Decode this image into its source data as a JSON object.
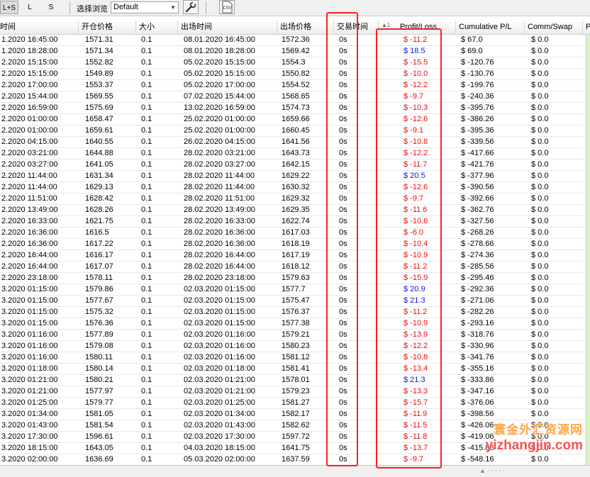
{
  "toolbar": {
    "btn_ls": "L+S",
    "btn_l": "L",
    "btn_s": "S",
    "browse_label": "选择浏览",
    "browse_value": "Default",
    "csv_label": "CSV"
  },
  "columns": [
    {
      "key": "entry_time",
      "label": "时间"
    },
    {
      "key": "entry_price",
      "label": "开仓价格"
    },
    {
      "key": "size",
      "label": "大小"
    },
    {
      "key": "exit_time",
      "label": "出场时间"
    },
    {
      "key": "exit_price",
      "label": "出场价格"
    },
    {
      "key": "duration",
      "label": "交易时间"
    },
    {
      "key": "pl",
      "label": "Profit/Loss"
    },
    {
      "key": "cum_pl",
      "label": "Cumulative P/L"
    },
    {
      "key": "comm",
      "label": "Comm/Swap"
    },
    {
      "key": "p",
      "label": "P"
    }
  ],
  "sort_indicator": "▲1",
  "rows": [
    [
      "1.2020 16:45:00",
      "1571.31",
      "0.1",
      "08.01.2020 16:45:00",
      "1572.36",
      "0s",
      "$ -11.2",
      "$ 67.0",
      "$ 0.0"
    ],
    [
      "1.2020 18:28:00",
      "1571.34",
      "0.1",
      "08.01.2020 18:28:00",
      "1569.42",
      "0s",
      "$ 18.5",
      "$ 69.0",
      "$ 0.0"
    ],
    [
      "2.2020 15:15:00",
      "1552.82",
      "0.1",
      "05.02.2020 15:15:00",
      "1554.3",
      "0s",
      "$ -15.5",
      "$ -120.76",
      "$ 0.0"
    ],
    [
      "2.2020 15:15:00",
      "1549.89",
      "0.1",
      "05.02.2020 15:15:00",
      "1550.82",
      "0s",
      "$ -10.0",
      "$ -130.76",
      "$ 0.0"
    ],
    [
      "2.2020 17:00:00",
      "1553.37",
      "0.1",
      "05.02.2020 17:00:00",
      "1554.52",
      "0s",
      "$ -12.2",
      "$ -199.76",
      "$ 0.0"
    ],
    [
      "2.2020 15:44:00",
      "1569.55",
      "0.1",
      "07.02.2020 15:44:00",
      "1568.65",
      "0s",
      "$ -9.7",
      "$ -240.36",
      "$ 0.0"
    ],
    [
      "2.2020 16:59:00",
      "1575.69",
      "0.1",
      "13.02.2020 16:59:00",
      "1574.73",
      "0s",
      "$ -10.3",
      "$ -395.76",
      "$ 0.0"
    ],
    [
      "2.2020 01:00:00",
      "1658.47",
      "0.1",
      "25.02.2020 01:00:00",
      "1659.66",
      "0s",
      "$ -12.6",
      "$ -386.26",
      "$ 0.0"
    ],
    [
      "2.2020 01:00:00",
      "1659.61",
      "0.1",
      "25.02.2020 01:00:00",
      "1660.45",
      "0s",
      "$ -9.1",
      "$ -395.36",
      "$ 0.0"
    ],
    [
      "2.2020 04:15:00",
      "1640.55",
      "0.1",
      "26.02.2020 04:15:00",
      "1641.56",
      "0s",
      "$ -10.8",
      "$ -339.56",
      "$ 0.0"
    ],
    [
      "2.2020 03:21:00",
      "1644.88",
      "0.1",
      "28.02.2020 03:21:00",
      "1643.73",
      "0s",
      "$ -12.2",
      "$ -417.66",
      "$ 0.0"
    ],
    [
      "2.2020 03:27:00",
      "1641.05",
      "0.1",
      "28.02.2020 03:27:00",
      "1642.15",
      "0s",
      "$ -11.7",
      "$ -421.76",
      "$ 0.0"
    ],
    [
      "2.2020 11:44:00",
      "1631.34",
      "0.1",
      "28.02.2020 11:44:00",
      "1629.22",
      "0s",
      "$ 20.5",
      "$ -377.96",
      "$ 0.0"
    ],
    [
      "2.2020 11:44:00",
      "1629.13",
      "0.1",
      "28.02.2020 11:44:00",
      "1630.32",
      "0s",
      "$ -12.6",
      "$ -390.56",
      "$ 0.0"
    ],
    [
      "2.2020 11:51:00",
      "1628.42",
      "0.1",
      "28.02.2020 11:51:00",
      "1629.32",
      "0s",
      "$ -9.7",
      "$ -392.66",
      "$ 0.0"
    ],
    [
      "2.2020 13:49:00",
      "1628.26",
      "0.1",
      "28.02.2020 13:49:00",
      "1629.35",
      "0s",
      "$ -11.6",
      "$ -362.76",
      "$ 0.0"
    ],
    [
      "2.2020 16:33:00",
      "1621.75",
      "0.1",
      "28.02.2020 16:33:00",
      "1622.74",
      "0s",
      "$ -10.6",
      "$ -327.56",
      "$ 0.0"
    ],
    [
      "2.2020 16:36:00",
      "1616.5",
      "0.1",
      "28.02.2020 16:36:00",
      "1617.03",
      "0s",
      "$ -6.0",
      "$ -268.26",
      "$ 0.0"
    ],
    [
      "2.2020 16:36:00",
      "1617.22",
      "0.1",
      "28.02.2020 16:36:00",
      "1618.19",
      "0s",
      "$ -10.4",
      "$ -278.66",
      "$ 0.0"
    ],
    [
      "2.2020 16:44:00",
      "1616.17",
      "0.1",
      "28.02.2020 16:44:00",
      "1617.19",
      "0s",
      "$ -10.9",
      "$ -274.36",
      "$ 0.0"
    ],
    [
      "2.2020 16:44:00",
      "1617.07",
      "0.1",
      "28.02.2020 16:44:00",
      "1618.12",
      "0s",
      "$ -11.2",
      "$ -285.56",
      "$ 0.0"
    ],
    [
      "2.2020 23:18:00",
      "1578.11",
      "0.1",
      "28.02.2020 23:18:00",
      "1579.63",
      "0s",
      "$ -15.9",
      "$ -295.46",
      "$ 0.0"
    ],
    [
      "3.2020 01:15:00",
      "1579.86",
      "0.1",
      "02.03.2020 01:15:00",
      "1577.7",
      "0s",
      "$ 20.9",
      "$ -292.36",
      "$ 0.0"
    ],
    [
      "3.2020 01:15:00",
      "1577.67",
      "0.1",
      "02.03.2020 01:15:00",
      "1575.47",
      "0s",
      "$ 21.3",
      "$ -271.06",
      "$ 0.0"
    ],
    [
      "3.2020 01:15:00",
      "1575.32",
      "0.1",
      "02.03.2020 01:15:00",
      "1576.37",
      "0s",
      "$ -11.2",
      "$ -282.26",
      "$ 0.0"
    ],
    [
      "3.2020 01:15:00",
      "1576.36",
      "0.1",
      "02.03.2020 01:15:00",
      "1577.38",
      "0s",
      "$ -10.9",
      "$ -293.16",
      "$ 0.0"
    ],
    [
      "3.2020 01:16:00",
      "1577.89",
      "0.1",
      "02.03.2020 01:16:00",
      "1579.21",
      "0s",
      "$ -13.9",
      "$ -318.76",
      "$ 0.0"
    ],
    [
      "3.2020 01:16:00",
      "1579.08",
      "0.1",
      "02.03.2020 01:16:00",
      "1580.23",
      "0s",
      "$ -12.2",
      "$ -330.96",
      "$ 0.0"
    ],
    [
      "3.2020 01:16:00",
      "1580.11",
      "0.1",
      "02.03.2020 01:16:00",
      "1581.12",
      "0s",
      "$ -10.8",
      "$ -341.76",
      "$ 0.0"
    ],
    [
      "3.2020 01:18:00",
      "1580.14",
      "0.1",
      "02.03.2020 01:18:00",
      "1581.41",
      "0s",
      "$ -13.4",
      "$ -355.16",
      "$ 0.0"
    ],
    [
      "3.2020 01:21:00",
      "1580.21",
      "0.1",
      "02.03.2020 01:21:00",
      "1578.01",
      "0s",
      "$ 21.3",
      "$ -333.86",
      "$ 0.0"
    ],
    [
      "3.2020 01:21:00",
      "1577.97",
      "0.1",
      "02.03.2020 01:21:00",
      "1579.23",
      "0s",
      "$ -13.3",
      "$ -347.16",
      "$ 0.0"
    ],
    [
      "3.2020 01:25:00",
      "1579.77",
      "0.1",
      "02.03.2020 01:25:00",
      "1581.27",
      "0s",
      "$ -15.7",
      "$ -376.06",
      "$ 0.0"
    ],
    [
      "3.2020 01:34:00",
      "1581.05",
      "0.1",
      "02.03.2020 01:34:00",
      "1582.17",
      "0s",
      "$ -11.9",
      "$ -398.56",
      "$ 0.0"
    ],
    [
      "3.2020 01:43:00",
      "1581.54",
      "0.1",
      "02.03.2020 01:43:00",
      "1582.62",
      "0s",
      "$ -11.5",
      "$ -426.06",
      "$ 0.0"
    ],
    [
      "3.2020 17:30:00",
      "1596.61",
      "0.1",
      "02.03.2020 17:30:00",
      "1597.72",
      "0s",
      "$ -11.8",
      "$ -419.06",
      "$ 0.0"
    ],
    [
      "3.2020 18:15:00",
      "1643.05",
      "0.1",
      "04.03.2020 18:15:00",
      "1641.75",
      "0s",
      "$ -13.7",
      "$ -415.86",
      "$ 0.0"
    ],
    [
      "3.2020 02:00:00",
      "1636.69",
      "0.1",
      "05.03.2020 02:00:00",
      "1637.59",
      "0s",
      "$ -9.7",
      "$ -548.16",
      "$ 0.0"
    ]
  ],
  "watermark": {
    "line1": "寰金外汇资源网",
    "line2": "yizhangjin.com"
  },
  "colors": {
    "loss": "#e81010",
    "gain": "#1010e8",
    "annotation": "#ff2020"
  }
}
